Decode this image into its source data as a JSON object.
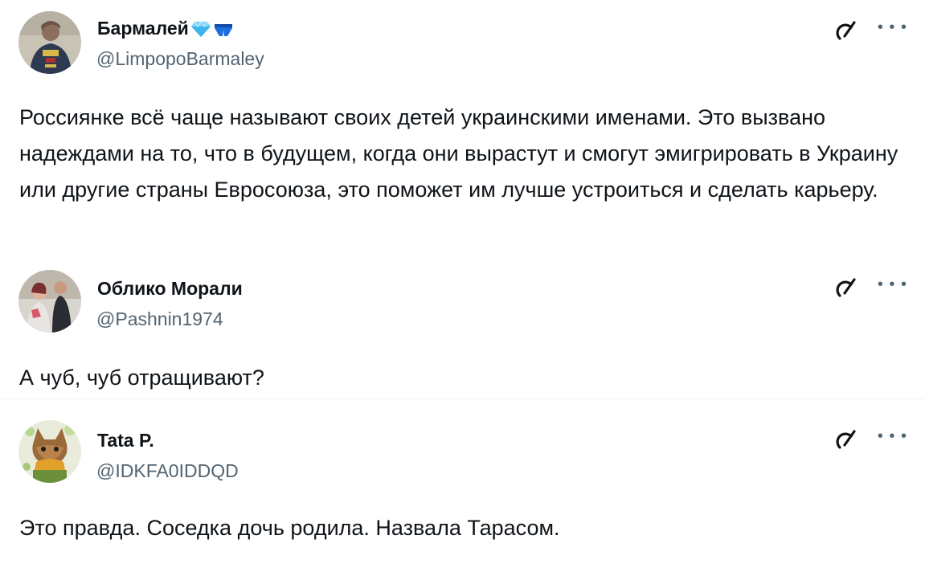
{
  "tweets": [
    {
      "display_name": "Бармалей",
      "handle": "@LimpopoBarmaley",
      "badges": [
        "diamond-icon",
        "shorts-icon"
      ],
      "text": "Россиянке всё чаще называют своих детей украинскими именами. Это вызвано надеждами на то, что в будущем, когда они вырастут и смогут эмигрировать в Украину или другие страны Евросоюза, это поможет им лучше устроиться и сделать карьеру."
    },
    {
      "display_name": "Облико Морали",
      "handle": "@Pashnin1974",
      "text": "А чуб, чуб отращивают?"
    },
    {
      "display_name": "Tata P.",
      "handle": "@IDKFA0IDDQD",
      "text": "Это правда. Соседка дочь родила. Назвала Тарасом."
    }
  ],
  "colors": {
    "text_primary": "#0f1419",
    "text_secondary": "#536471",
    "badge_blue": "#1d9bf0"
  },
  "icons": {
    "grok": "grok-icon",
    "more": "more-icon"
  }
}
